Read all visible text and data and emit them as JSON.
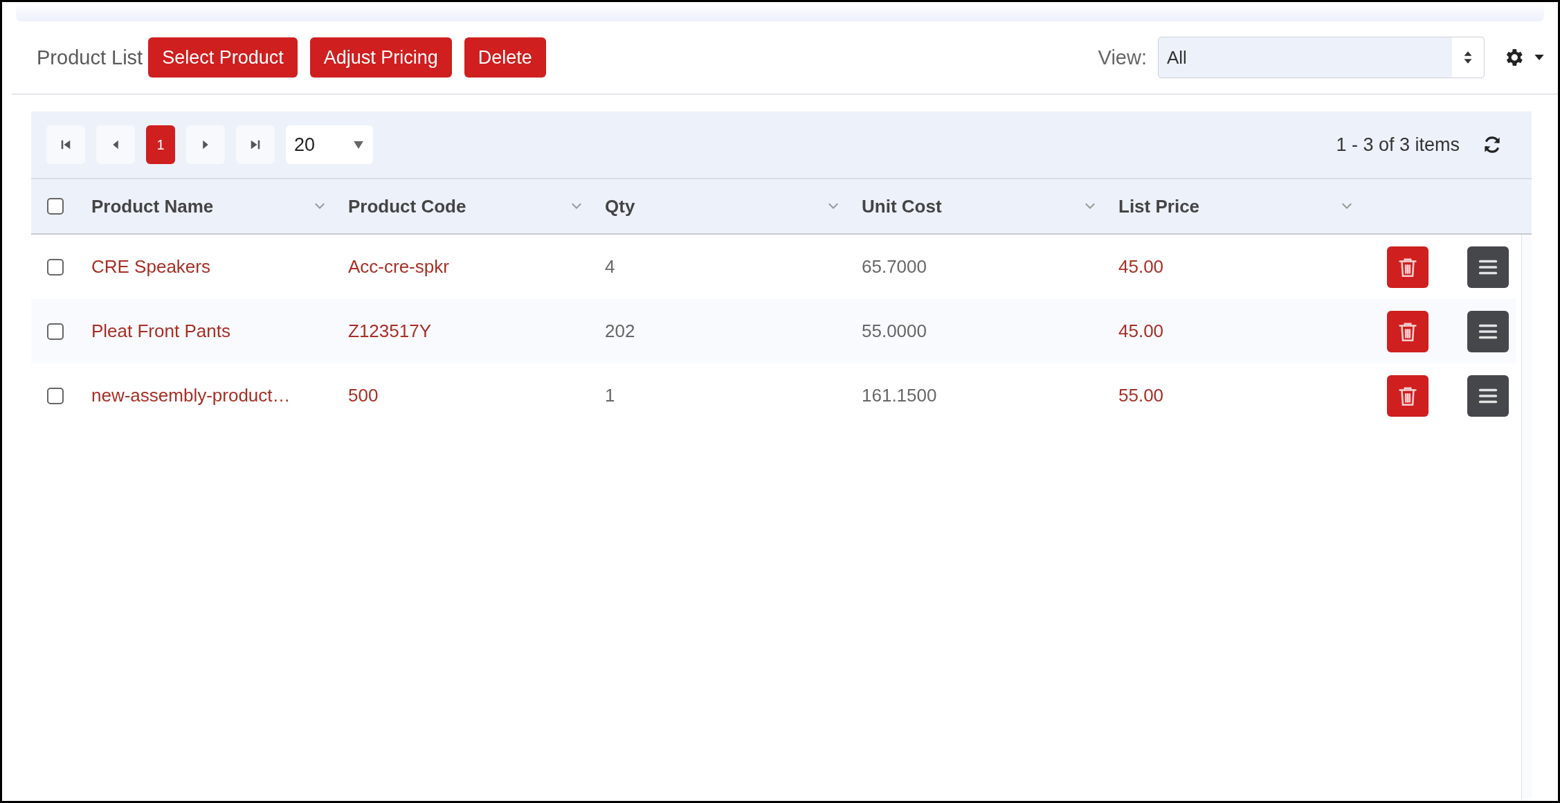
{
  "toolbar": {
    "title": "Product List",
    "buttons": [
      "Select Product",
      "Adjust Pricing",
      "Delete"
    ],
    "view_label": "View:",
    "view_value": "All"
  },
  "pager": {
    "pages": [
      {
        "label": "1",
        "selected": true
      }
    ],
    "page_size": "20",
    "summary": "1 - 3 of 3 items"
  },
  "table": {
    "header_checked": false,
    "columns": [
      {
        "label": "Product Name",
        "kind": "link"
      },
      {
        "label": "Product Code",
        "kind": "link"
      },
      {
        "label": "Qty",
        "kind": "text"
      },
      {
        "label": "Unit Cost",
        "kind": "text"
      },
      {
        "label": "List Price",
        "kind": "link"
      }
    ],
    "rows": [
      {
        "checked": false,
        "cells": [
          "CRE Speakers",
          "Acc-cre-spkr",
          "4",
          "65.7000",
          "45.00"
        ]
      },
      {
        "checked": false,
        "cells": [
          "Pleat Front Pants",
          "Z123517Y",
          "202",
          "55.0000",
          "45.00"
        ]
      },
      {
        "checked": false,
        "cells": [
          "new-assembly-product…",
          "500",
          "1",
          "161.1500",
          "55.00"
        ]
      }
    ]
  }
}
